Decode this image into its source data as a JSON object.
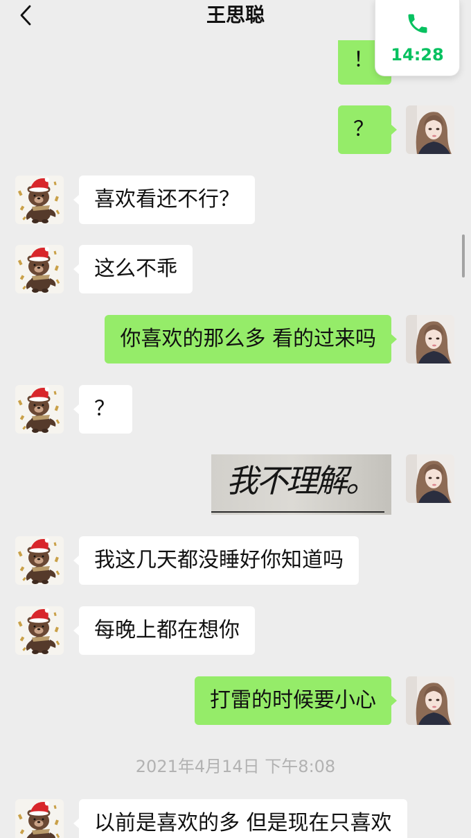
{
  "colors": {
    "background": "#ededed",
    "outgoing_bubble": "#95ec69",
    "incoming_bubble": "#ffffff",
    "accent_green": "#07c160",
    "timestamp_gray": "#b2b2b2"
  },
  "header": {
    "back_icon": "chevron-left-icon",
    "title": "王思聪"
  },
  "call_widget": {
    "icon": "phone-icon",
    "duration": "14:28"
  },
  "avatars": {
    "contact_icon": "bear-avatar-icon",
    "self_icon": "girl-avatar-icon"
  },
  "messages": [
    {
      "outgoing": true,
      "text": "！"
    },
    {
      "outgoing": true,
      "text": "？"
    },
    {
      "outgoing": false,
      "text": "喜欢看还不行？"
    },
    {
      "outgoing": false,
      "text": "这么不乖"
    },
    {
      "outgoing": true,
      "text": "你喜欢的那么多 看的过来吗"
    },
    {
      "outgoing": false,
      "text": "？"
    },
    {
      "outgoing": true,
      "is_image": true,
      "text": "我不理解。"
    },
    {
      "outgoing": false,
      "text": "我这几天都没睡好你知道吗"
    },
    {
      "outgoing": false,
      "text": "每晚上都在想你"
    },
    {
      "outgoing": true,
      "text": "打雷的时候要小心"
    },
    {
      "time": "2021年4月14日 下午8:08"
    },
    {
      "outgoing": false,
      "text": "以前是喜欢的多 但是现在只喜欢"
    }
  ]
}
